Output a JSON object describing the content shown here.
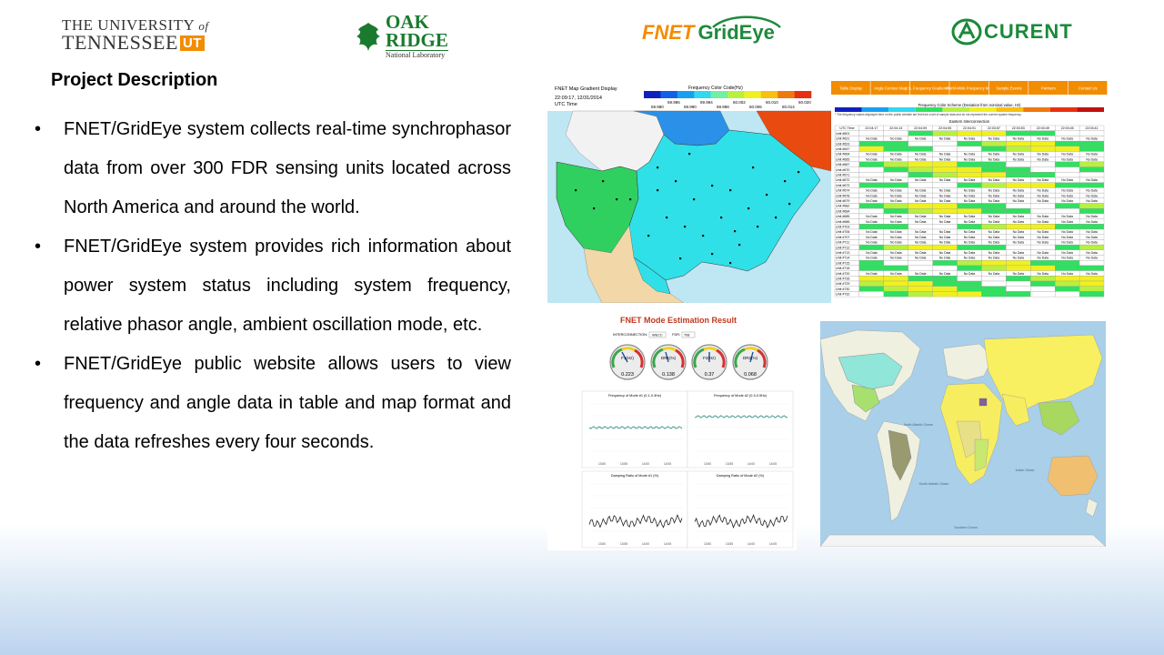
{
  "logos": {
    "ut_line1": "THE UNIVERSITY",
    "ut_of": "of",
    "ut_line2": "TENNESSEE",
    "ut_mark": "UT",
    "ornl_line1": "OAK",
    "ornl_line2": "RIDGE",
    "ornl_line3": "National Laboratory",
    "fnet_prefix": "FNET",
    "fnet_suffix": "GridEye",
    "curent": "CURENT"
  },
  "title": "Project Description",
  "bullets": [
    "FNET/GridEye system collects real-time synchrophasor data from over 300 FDR sensing units located across North America and around the world.",
    "FNET/GridEye system  provides rich information about power system status including system frequency, relative phasor angle, ambient oscillation mode, etc.",
    "FNET/GridEye public website allows users to view frequency and angle data in table and map format and the data refreshes every four seconds."
  ],
  "freq_map": {
    "title": "FNET Map Gradient Display",
    "time": "22:09:17, 12/31/2014",
    "tz": "UTC Time",
    "legend_title": "Frequency Color Code(Hz)",
    "legend_ticks_top": [
      "59.986",
      "59.994",
      "60.002",
      "60.010",
      "60.020"
    ],
    "legend_ticks_bottom": [
      "59.980",
      "59.990",
      "59.998",
      "60.006",
      "60.014"
    ],
    "legend_colors": [
      "#1020c0",
      "#1060e8",
      "#18a0f0",
      "#30d8f0",
      "#70f0a0",
      "#b8f040",
      "#f0f020",
      "#f8c010",
      "#f07810",
      "#e83010"
    ]
  },
  "table": {
    "nav": [
      "Table Display",
      "Angle Contour Map",
      "U.S. Frequency Gradient Map",
      "World-Wide Frequency Map",
      "Sample Events",
      "Partners",
      "Contact Us"
    ],
    "scheme_title": "Frequency Color Scheme (Deviation from nominal value, Hz)",
    "note": "* The frequency values displayed here on the public website are fed from a set of sample data and do not represent the current system frequency.",
    "section": "Eastern Interconnection",
    "columns": [
      "UTC Time",
      "22:04:17",
      "22:04:13",
      "22:04:09",
      "22:04:05",
      "22:04:01",
      "22:03:57",
      "22:03:53",
      "22:03:49",
      "22:03:45",
      "22:03:41"
    ],
    "rows": [
      "Unit #601",
      "Unit #621",
      "Unit #623",
      "Unit #647",
      "Unit #664",
      "Unit #665",
      "Unit #667",
      "Unit #670",
      "Unit #671",
      "Unit #672",
      "Unit #673",
      "Unit #674",
      "Unit #678",
      "Unit #679",
      "Unit #682",
      "Unit #684",
      "Unit #685",
      "Unit #686",
      "Unit #703",
      "Unit #706",
      "Unit #707",
      "Unit #711",
      "Unit #712",
      "Unit #713",
      "Unit #714",
      "Unit #715",
      "Unit #718",
      "Unit #720",
      "Unit #726",
      "Unit #729",
      "Unit #730",
      "Unit #732"
    ],
    "no_data": "No Data"
  },
  "mode": {
    "title": "FNET Mode Estimation Result",
    "interconnection_label": "INTERCONNECTION:",
    "interconnection_value": "WECC",
    "fdr_label": "FDR:",
    "fdr_value": "708",
    "gauges": [
      {
        "label": "F1(Hz)",
        "value": "0.223"
      },
      {
        "label": "DR1(%)",
        "value": "0.138"
      },
      {
        "label": "F2(Hz)",
        "value": "0.37"
      },
      {
        "label": "DR2(%)",
        "value": "0.068"
      }
    ],
    "chart_titles": [
      "Frequency of Mode #1 (0.1-0.3Hz)",
      "Frequency of Mode #2 (0.3-0.5Hz)",
      "Damping Ratio of Mode #1 (%)",
      "Damping Ratio of Mode #2 (%)"
    ],
    "time_ticks": [
      "13:50",
      "13:55",
      "14:00",
      "14:05"
    ]
  },
  "world_map": {
    "labels": [
      "North Atlantic Ocean",
      "South Atlantic Ocean",
      "Indian Ocean",
      "Southern Ocean"
    ]
  }
}
